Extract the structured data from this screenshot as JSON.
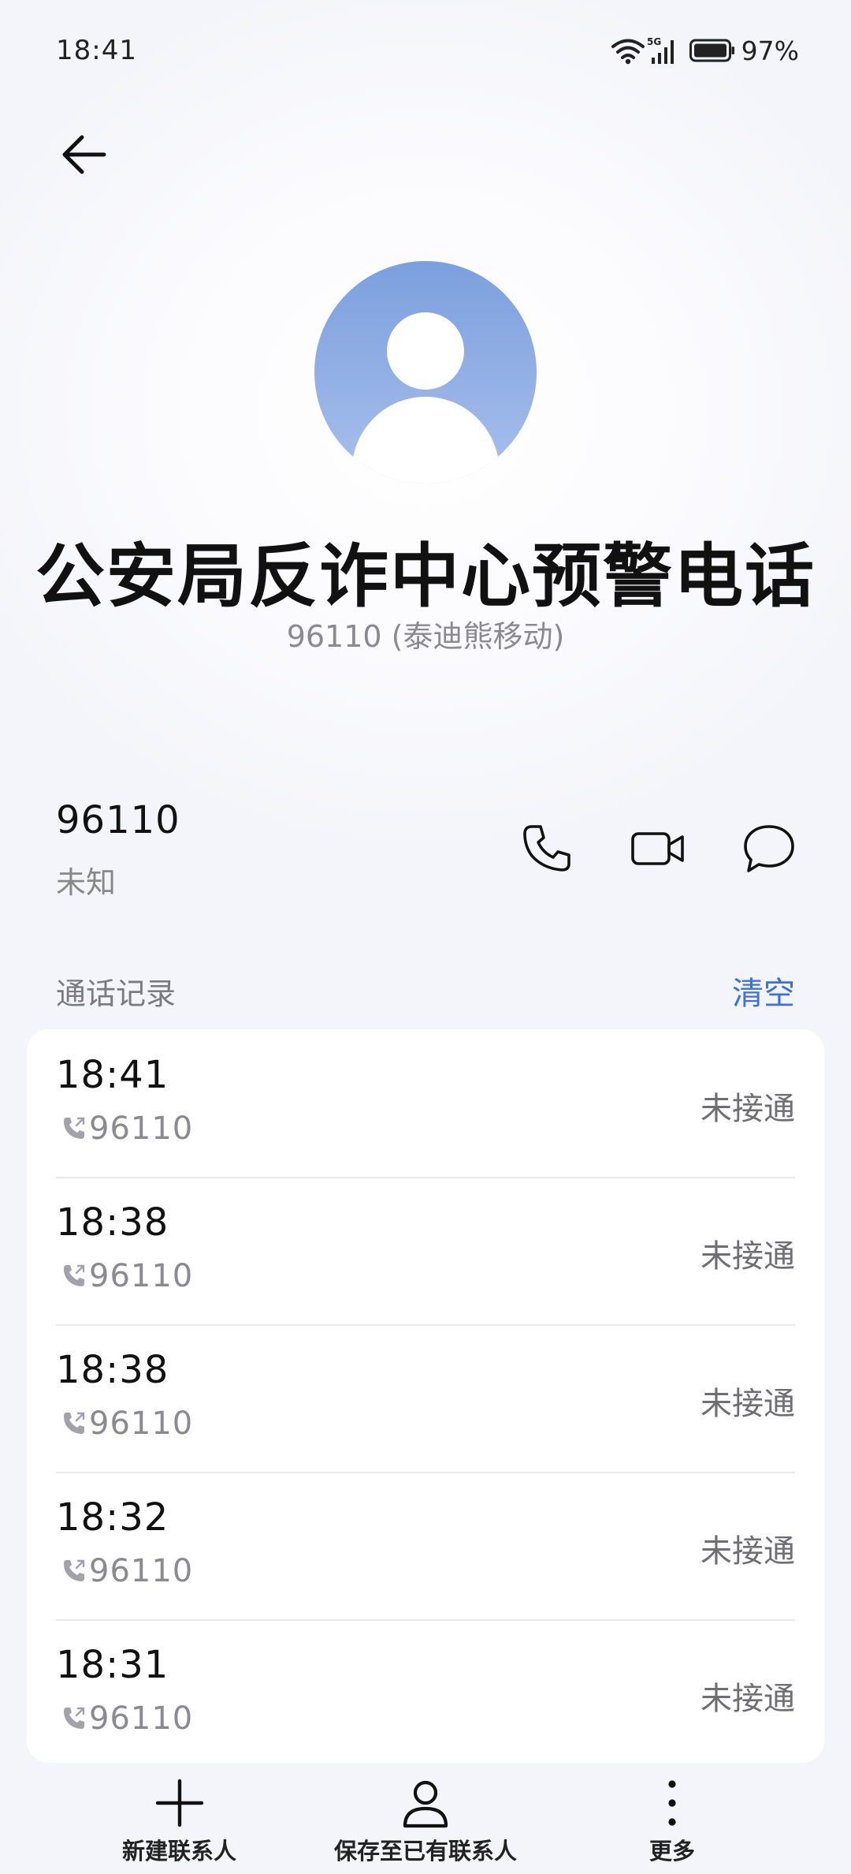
{
  "status_bar": {
    "time": "18:41",
    "network": "5G",
    "battery": "97%"
  },
  "contact": {
    "name": "公安局反诈中心预警电话",
    "subtitle": "96110 (泰迪熊移动)"
  },
  "number_row": {
    "number": "96110",
    "type": "未知"
  },
  "history": {
    "title": "通话记录",
    "clear_label": "清空",
    "rows": [
      {
        "time": "18:41",
        "number": "96110",
        "status": "未接通"
      },
      {
        "time": "18:38",
        "number": "96110",
        "status": "未接通"
      },
      {
        "time": "18:38",
        "number": "96110",
        "status": "未接通"
      },
      {
        "time": "18:32",
        "number": "96110",
        "status": "未接通"
      },
      {
        "time": "18:31",
        "number": "96110",
        "status": "未接通"
      }
    ]
  },
  "bottom_bar": {
    "new_contact": "新建联系人",
    "save_existing": "保存至已有联系人",
    "more": "更多"
  },
  "colors": {
    "accent": "#3b6fe4",
    "avatar": "#8fabe4"
  }
}
